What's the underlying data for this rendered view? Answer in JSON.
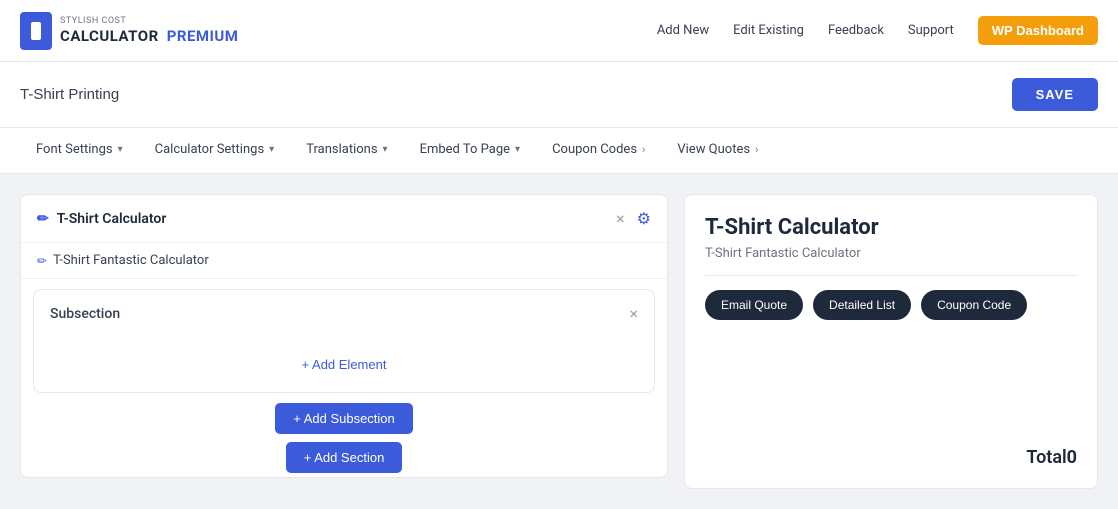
{
  "header": {
    "logo_stylish": "STYLISH COST",
    "logo_calc": "CALCULATOR",
    "logo_premium": "PREMIUM",
    "nav": {
      "add_new": "Add New",
      "edit_existing": "Edit Existing",
      "feedback": "Feedback",
      "support": "Support",
      "wp_dashboard": "WP Dashboard"
    }
  },
  "title_bar": {
    "calculator_name": "T-Shirt Printing",
    "save_label": "SAVE"
  },
  "tabs": [
    {
      "label": "Font Settings",
      "type": "dropdown"
    },
    {
      "label": "Calculator Settings",
      "type": "dropdown"
    },
    {
      "label": "Translations",
      "type": "dropdown"
    },
    {
      "label": "Embed To Page",
      "type": "dropdown"
    },
    {
      "label": "Coupon Codes",
      "type": "arrow"
    },
    {
      "label": "View Quotes",
      "type": "arrow"
    }
  ],
  "section": {
    "title": "T-Shirt Calculator",
    "subtitle": "T-Shirt Fantastic Calculator",
    "close_icon": "×",
    "gear_icon": "⚙",
    "pencil_icon": "✏"
  },
  "subsection": {
    "title": "Subsection",
    "close_icon": "×"
  },
  "buttons": {
    "add_element": "+ Add Element",
    "add_subsection": "+ Add Subsection",
    "add_section": "+ Add Section"
  },
  "preview": {
    "title": "T-Shirt Calculator",
    "subtitle": "T-Shirt Fantastic Calculator",
    "action_buttons": [
      {
        "label": "Email Quote"
      },
      {
        "label": "Detailed List"
      },
      {
        "label": "Coupon Code"
      }
    ],
    "total_label": "Total",
    "total_value": "0"
  }
}
